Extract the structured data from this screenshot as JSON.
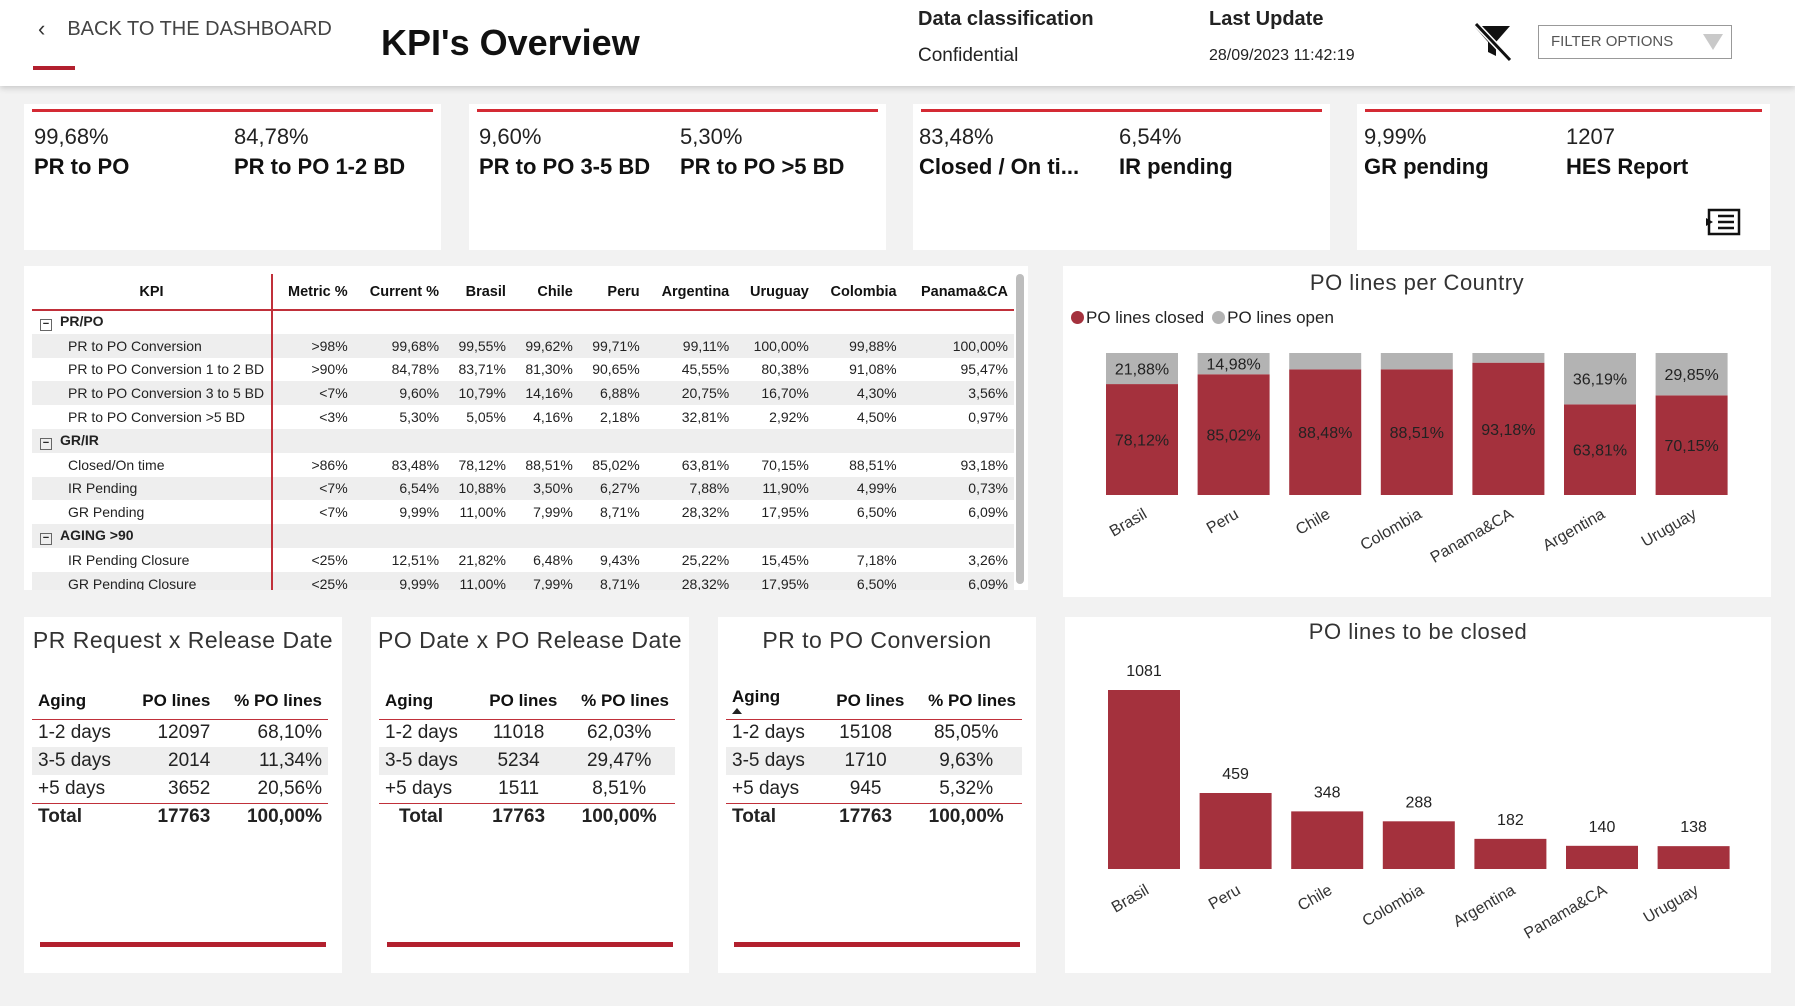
{
  "header": {
    "back_label": "BACK TO THE DASHBOARD",
    "title": "KPI's Overview",
    "classification_label": "Data classification",
    "classification_value": "Confidential",
    "update_label": "Last Update",
    "update_value": "28/09/2023 11:42:19",
    "filter_placeholder": "FILTER OPTIONS",
    "accent_color": "#b2202e"
  },
  "cards": [
    {
      "kpis": [
        {
          "value": "99,68%",
          "label": "PR to PO"
        },
        {
          "value": "84,78%",
          "label": "PR to PO 1-2 BD"
        }
      ]
    },
    {
      "kpis": [
        {
          "value": "9,60%",
          "label": "PR to PO 3-5 BD"
        },
        {
          "value": "5,30%",
          "label": "PR to PO >5 BD"
        }
      ]
    },
    {
      "kpis": [
        {
          "value": "83,48%",
          "label": "Closed / On ti..."
        },
        {
          "value": "6,54%",
          "label": "IR pending"
        }
      ]
    },
    {
      "kpis": [
        {
          "value": "9,99%",
          "label": "GR pending"
        },
        {
          "value": "1207",
          "label": "HES Report"
        }
      ]
    }
  ],
  "matrix": {
    "headers": [
      "KPI",
      "Metric %",
      "Current %",
      "Brasil",
      "Chile",
      "Peru",
      "Argentina",
      "Uruguay",
      "Colombia",
      "Panama&CA"
    ],
    "rows": [
      {
        "type": "group",
        "name": "PR/PO",
        "expander": "−",
        "cells": [
          "",
          "",
          "",
          "",
          "",
          "",
          "",
          "",
          ""
        ]
      },
      {
        "type": "item",
        "name": "PR to PO Conversion",
        "cells": [
          ">98%",
          "99,68%",
          "99,55%",
          "99,62%",
          "99,71%",
          "99,11%",
          "100,00%",
          "99,88%",
          "100,00%"
        ]
      },
      {
        "type": "item",
        "name": "PR to PO Conversion 1 to 2 BD",
        "cells": [
          ">90%",
          "84,78%",
          "83,71%",
          "81,30%",
          "90,65%",
          "45,55%",
          "80,38%",
          "91,08%",
          "95,47%"
        ]
      },
      {
        "type": "item",
        "name": "PR to PO Conversion 3 to 5 BD",
        "cells": [
          "<7%",
          "9,60%",
          "10,79%",
          "14,16%",
          "6,88%",
          "20,75%",
          "16,70%",
          "4,30%",
          "3,56%"
        ]
      },
      {
        "type": "item",
        "name": "PR to PO Conversion >5 BD",
        "cells": [
          "<3%",
          "5,30%",
          "5,05%",
          "4,16%",
          "2,18%",
          "32,81%",
          "2,92%",
          "4,50%",
          "0,97%"
        ]
      },
      {
        "type": "group",
        "name": "GR/IR",
        "expander": "−",
        "cells": [
          "",
          "",
          "",
          "",
          "",
          "",
          "",
          "",
          ""
        ]
      },
      {
        "type": "item",
        "name": "Closed/On time",
        "cells": [
          ">86%",
          "83,48%",
          "78,12%",
          "88,51%",
          "85,02%",
          "63,81%",
          "70,15%",
          "88,51%",
          "93,18%"
        ]
      },
      {
        "type": "item",
        "name": "IR Pending",
        "cells": [
          "<7%",
          "6,54%",
          "10,88%",
          "3,50%",
          "6,27%",
          "7,88%",
          "11,90%",
          "4,99%",
          "0,73%"
        ]
      },
      {
        "type": "item",
        "name": "GR Pending",
        "cells": [
          "<7%",
          "9,99%",
          "11,00%",
          "7,99%",
          "8,71%",
          "28,32%",
          "17,95%",
          "6,50%",
          "6,09%"
        ]
      },
      {
        "type": "group",
        "name": "AGING >90",
        "expander": "−",
        "cells": [
          "",
          "",
          "",
          "",
          "",
          "",
          "",
          "",
          ""
        ]
      },
      {
        "type": "item",
        "name": "IR Pending Closure",
        "cells": [
          "<25%",
          "12,51%",
          "21,82%",
          "6,48%",
          "9,43%",
          "25,22%",
          "15,45%",
          "7,18%",
          "3,26%"
        ]
      },
      {
        "type": "item",
        "name": "GR Pending Closure",
        "cells": [
          "<25%",
          "9,99%",
          "11,00%",
          "7,99%",
          "8,71%",
          "28,32%",
          "17,95%",
          "6,50%",
          "6,09%"
        ]
      }
    ]
  },
  "chart_data": [
    {
      "type": "bar",
      "stacked": true,
      "percent_stacked": true,
      "title": "PO lines per Country",
      "categories": [
        "Brasil",
        "Peru",
        "Chile",
        "Colombia",
        "Panama&CA",
        "Argentina",
        "Uruguay"
      ],
      "series": [
        {
          "name": "PO lines closed",
          "color": "#a4313d",
          "values": [
            78.12,
            85.02,
            88.48,
            88.51,
            93.18,
            63.81,
            70.15
          ],
          "labels": [
            "78,12%",
            "85,02%",
            "88,48%",
            "88,51%",
            "93,18%",
            "63,81%",
            "70,15%"
          ]
        },
        {
          "name": "PO lines open",
          "color": "#b3b3b3",
          "values": [
            21.88,
            14.98,
            11.52,
            11.49,
            6.82,
            36.19,
            29.85
          ],
          "labels": [
            "21,88%",
            "14,98%",
            "",
            "",
            "",
            "36,19%",
            "29,85%"
          ]
        }
      ],
      "ylim": [
        0,
        100
      ],
      "legend": "top-left",
      "grid": false
    },
    {
      "type": "bar",
      "title": "PO lines to be closed",
      "categories": [
        "Brasil",
        "Peru",
        "Chile",
        "Colombia",
        "Argentina",
        "Panama&CA",
        "Uruguay"
      ],
      "values": [
        1081,
        459,
        348,
        288,
        182,
        140,
        138
      ],
      "color": "#a4313d",
      "ylim": [
        0,
        1081
      ],
      "grid": false
    }
  ],
  "aging_tables": [
    {
      "title": "PR Request x Release Date",
      "headers": [
        "Aging",
        "PO lines",
        "% PO lines"
      ],
      "rows": [
        [
          "1-2 days",
          "12097",
          "68,10%"
        ],
        [
          "3-5 days",
          "2014",
          "11,34%"
        ],
        [
          "+5 days",
          "3652",
          "20,56%"
        ]
      ],
      "total": [
        "Total",
        "17763",
        "100,00%"
      ]
    },
    {
      "title": "PO Date x PO Release Date",
      "headers": [
        "Aging",
        "PO lines",
        "% PO lines"
      ],
      "rows": [
        [
          "1-2 days",
          "11018",
          "62,03%"
        ],
        [
          "3-5 days",
          "5234",
          "29,47%"
        ],
        [
          "+5 days",
          "1511",
          "8,51%"
        ]
      ],
      "total": [
        "Total",
        "17763",
        "100,00%"
      ]
    },
    {
      "title": "PR to PO Conversion",
      "headers": [
        "Aging",
        "PO lines",
        "% PO lines"
      ],
      "rows": [
        [
          "1-2 days",
          "15108",
          "85,05%"
        ],
        [
          "3-5 days",
          "1710",
          "9,63%"
        ],
        [
          "+5 days",
          "945",
          "5,32%"
        ]
      ],
      "total": [
        "Total",
        "17763",
        "100,00%"
      ]
    }
  ],
  "icons": {
    "back": "chevron-left-icon",
    "clear_filter": "filter-clear-icon",
    "dropdown": "dropdown-triangle-icon",
    "report": "report-icon",
    "expander": "collapse-icon"
  }
}
